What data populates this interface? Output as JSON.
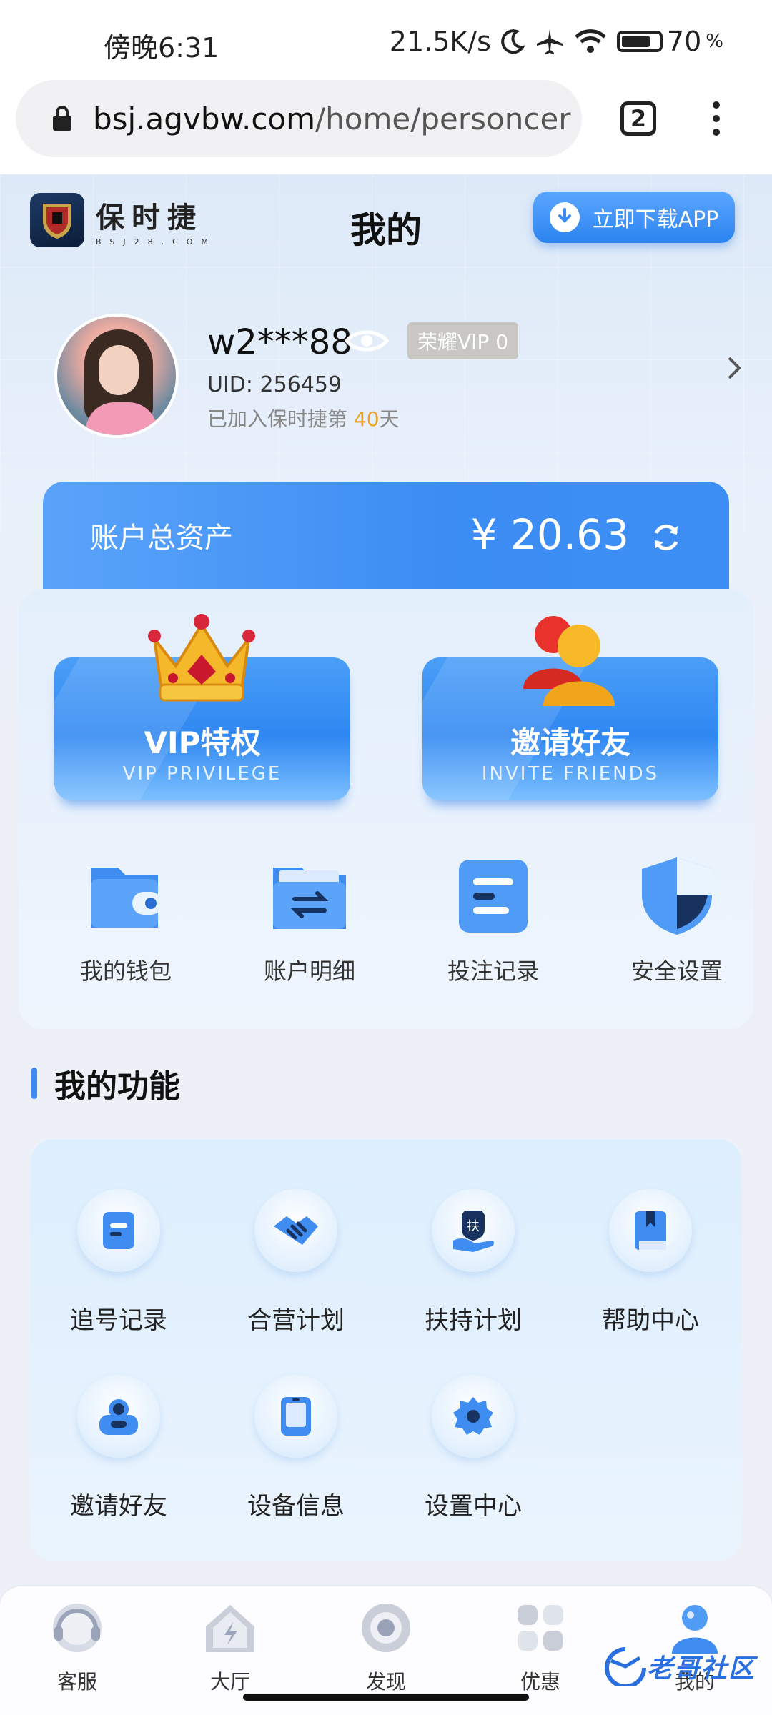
{
  "status_bar": {
    "time": "傍晚6:31",
    "network_speed": "21.5K/s",
    "battery": "70",
    "battery_unit": "%"
  },
  "browser": {
    "url_domain": "bsj.agvbw.com",
    "url_path": "/home/personcer",
    "tab_count": "2"
  },
  "header": {
    "logo_cn": "保时捷",
    "logo_en": "BSJ28.COM",
    "title": "我的",
    "download_label": "立即下载APP"
  },
  "profile": {
    "username": "w2***88",
    "vip_badge": "荣耀VIP 0",
    "uid": "UID: 256459",
    "joined_prefix": "已加入保时捷第 ",
    "joined_days": "40",
    "joined_suffix": "天"
  },
  "assets": {
    "label": "账户总资产",
    "value": "¥ 20.63"
  },
  "promos": [
    {
      "title": "VIP特权",
      "subtitle": "VIP PRIVILEGE"
    },
    {
      "title": "邀请好友",
      "subtitle": "INVITE FRIENDS"
    }
  ],
  "quick_actions": [
    {
      "label": "我的钱包",
      "icon": "wallet-icon"
    },
    {
      "label": "账户明细",
      "icon": "folder-transfer-icon"
    },
    {
      "label": "投注记录",
      "icon": "document-icon"
    },
    {
      "label": "安全设置",
      "icon": "shield-icon"
    }
  ],
  "functions": {
    "title": "我的功能",
    "items": [
      {
        "label": "追号记录",
        "icon": "note-icon"
      },
      {
        "label": "合营计划",
        "icon": "handshake-icon"
      },
      {
        "label": "扶持计划",
        "icon": "support-hand-icon"
      },
      {
        "label": "帮助中心",
        "icon": "book-icon"
      },
      {
        "label": "邀请好友",
        "icon": "users-icon"
      },
      {
        "label": "设备信息",
        "icon": "tablet-icon"
      },
      {
        "label": "设置中心",
        "icon": "gear-icon"
      }
    ]
  },
  "bottom_nav": [
    {
      "label": "客服",
      "icon": "headset-icon"
    },
    {
      "label": "大厅",
      "icon": "home-icon"
    },
    {
      "label": "发现",
      "icon": "discover-icon"
    },
    {
      "label": "优惠",
      "icon": "gift-icon"
    },
    {
      "label": "我的",
      "icon": "user-icon",
      "active": true
    }
  ],
  "watermark": "老哥社区",
  "colors": {
    "accent": "#3a8cf2",
    "gold": "#f0a21a"
  }
}
